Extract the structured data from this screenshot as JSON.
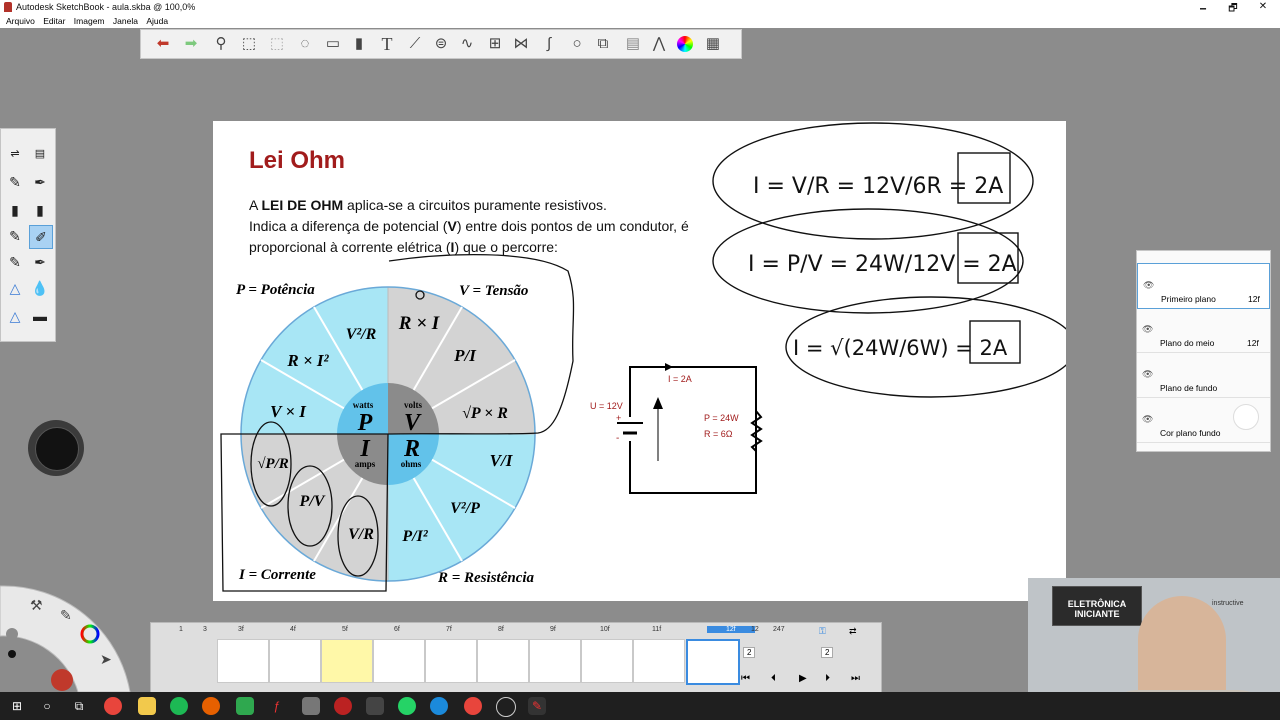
{
  "window": {
    "title": "Autodesk SketchBook - aula.skba @ 100,0%",
    "min": "🗕",
    "max": "🗗",
    "close": "✕"
  },
  "menu": [
    "Arquivo",
    "Editar",
    "Imagem",
    "Janela",
    "Ajuda"
  ],
  "toolbar_icons": [
    "undo-icon",
    "redo-icon",
    "zoom-icon",
    "select-icon",
    "crop-icon",
    "lasso-icon",
    "distort-icon",
    "fill-icon",
    "text-icon",
    "ruler-icon",
    "ellipse-guide-icon",
    "french-curve-icon",
    "perspective-icon",
    "symmetry-icon",
    "stroke-icon",
    "shape-icon",
    "copy-paste-icon",
    "layers-icon",
    "brushes-icon",
    "color-wheel-icon",
    "palette-icon"
  ],
  "canvas": {
    "title": "Lei Ohm",
    "line1_pre": "A ",
    "line1_bold": "LEI DE OHM",
    "line1_post": " aplica-se a circuitos puramente resistivos.",
    "line2_pre": "Indica a diferença de potencial (",
    "line2_bold": "V",
    "line2_post": ") entre dois pontos de um condutor, é",
    "line3_pre": "proporcional à corrente elétrica (",
    "line3_bold": "I",
    "line3_post": ") que o percorre:",
    "wheel": {
      "label_p": "P = Potência",
      "label_v": "V = Tensão",
      "label_i": "I = Corrente",
      "label_r": "R = Resistência",
      "center": {
        "watts": "watts",
        "P": "P",
        "volts": "volts",
        "V": "V",
        "I": "I",
        "amps": "amps",
        "R": "R",
        "ohms": "ohms"
      },
      "seg_v2_r": "V²/R",
      "seg_rxi2": "R × I²",
      "seg_vxi": "V × I",
      "seg_rxi": "R × I",
      "seg_p_i": "P/I",
      "seg_sqrt_pr": "√P × R",
      "seg_v_i": "V/I",
      "seg_v2_p": "V²/P",
      "seg_p_i2": "P/I²",
      "seg_sqrt_p_r": "√P/R",
      "seg_p_v": "P/V",
      "seg_v_r": "V/R"
    },
    "circuit": {
      "u": "U = 12V",
      "i": "I = 2A",
      "p": "P = 24W",
      "r": "R = 6Ω",
      "plus": "+",
      "minus": "-"
    },
    "handwriting": {
      "eq1": "I = V/R = 12V/6R = 2A",
      "eq2": "I = P/V = 24W/12V = 2A",
      "eq3": "I = √(24W/6W) = 2A"
    }
  },
  "layers": [
    {
      "name": "Primeiro plano",
      "opacity": "12f"
    },
    {
      "name": "Plano do meio",
      "opacity": "12f"
    },
    {
      "name": "Plano de fundo",
      "opacity": ""
    },
    {
      "name": "Cor plano fundo",
      "opacity": ""
    }
  ],
  "flipbook": {
    "start": "1",
    "range": "3",
    "frames": [
      "3f",
      "4f",
      "5f",
      "6f",
      "7f",
      "8f",
      "9f",
      "10f",
      "11f",
      "12f"
    ],
    "current": "12",
    "total": "247",
    "dd1": "2",
    "dd2": "2"
  },
  "webcam": {
    "banner1": "ELETRÔNICA",
    "banner2": "INICIANTE",
    "brand": "instructive"
  },
  "taskbar_icons": [
    "windows-start-icon",
    "search-icon",
    "task-view-icon",
    "chrome-icon",
    "file-explorer-icon",
    "firefox-icon",
    "spotify-icon",
    "sublime-icon",
    "app-icon",
    "app-icon",
    "app-icon",
    "app-icon",
    "whatsapp-icon",
    "edge-icon",
    "chrome-icon",
    "obs-icon",
    "sketchbook-icon"
  ],
  "colors": {
    "title_red": "#a11c1c",
    "wheel_blue": "#a8e6f5",
    "wheel_gray": "#d3d3d3",
    "center_blue": "#62c2ea",
    "center_gray": "#8b8b8b"
  }
}
